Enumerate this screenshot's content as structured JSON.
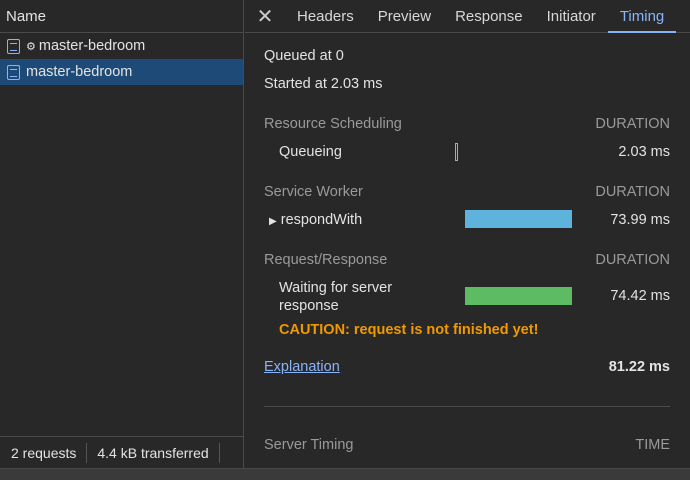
{
  "left": {
    "header": "Name",
    "rows": [
      {
        "label": "master-bedroom",
        "gear": "⚙"
      },
      {
        "label": "master-bedroom"
      }
    ],
    "footer": {
      "requests": "2 requests",
      "transferred": "4.4 kB transferred"
    }
  },
  "tabs": [
    "Headers",
    "Preview",
    "Response",
    "Initiator",
    "Timing"
  ],
  "timing": {
    "queued": "Queued at 0",
    "started": "Started at 2.03 ms",
    "resource_scheduling": "Resource Scheduling",
    "duration": "DURATION",
    "queueing": "Queueing",
    "queueing_val": "2.03 ms",
    "service_worker": "Service Worker",
    "respond_with": "respondWith",
    "respond_val": "73.99 ms",
    "request_response": "Request/Response",
    "waiting": "Waiting for server response",
    "waiting_val": "74.42 ms",
    "caution": "CAUTION: request is not finished yet!",
    "explanation": "Explanation",
    "total": "81.22 ms",
    "server_timing": "Server Timing",
    "time": "TIME"
  },
  "colors": {
    "service_worker_bar": "#5eb3dc",
    "waiting_bar": "#5dbb63"
  }
}
